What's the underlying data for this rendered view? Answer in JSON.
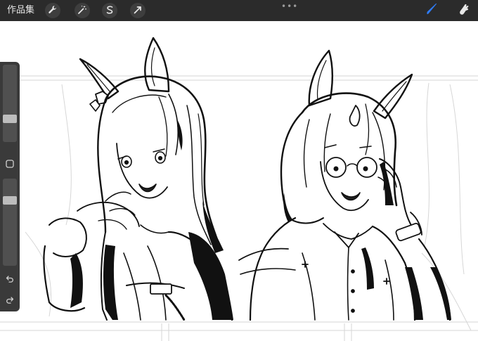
{
  "toolbar": {
    "gallery_label": "作品集",
    "tools": [
      "wrench-icon",
      "magic-wand-icon",
      "selection-s-icon",
      "transform-arrow-icon"
    ],
    "more_label": "•••",
    "right_tools": [
      "brush-icon",
      "smudge-icon"
    ],
    "accent_color": "#2f7cf6",
    "background_color": "#2b2b2b"
  },
  "sidebar": {
    "brush_size_level": 0.28,
    "opacity_level": 0.22,
    "modify_button": "square-icon",
    "undo": "undo-icon",
    "redo": "redo-icon"
  },
  "canvas": {
    "content": "black-and-white-line-art"
  }
}
